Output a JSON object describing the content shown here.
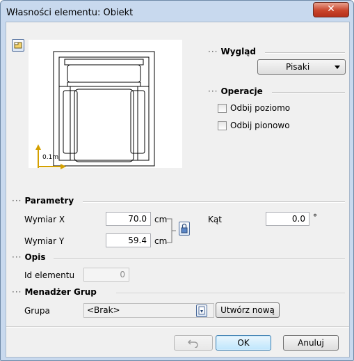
{
  "window": {
    "title": "Własności elementu: Obiekt",
    "close_glyph": "✕"
  },
  "preview": {
    "scale_label": "0.1m"
  },
  "wyglad": {
    "header": "Wygląd",
    "pens_dropdown": "Pisaki"
  },
  "operacje": {
    "header": "Operacje",
    "flip_h_label": "Odbij poziomo",
    "flip_v_label": "Odbij pionowo"
  },
  "parametry": {
    "header": "Parametry",
    "dim_x_label": "Wymiar X",
    "dim_x_value": "70.0",
    "dim_x_unit": "cm",
    "dim_y_label": "Wymiar Y",
    "dim_y_value": "59.4",
    "dim_y_unit": "cm",
    "angle_label": "Kąt",
    "angle_value": "0.0",
    "angle_unit": "°"
  },
  "opis": {
    "header": "Opis",
    "id_label": "Id elementu",
    "id_value": "0"
  },
  "grupy": {
    "header": "Menadżer Grup",
    "group_label": "Grupa",
    "group_value": "<Brak>",
    "create_button": "Utwórz nową"
  },
  "footer": {
    "ok_label": "OK",
    "cancel_label": "Anuluj"
  },
  "icons": [
    "preview-toggle-icon",
    "close-icon",
    "chevron-down-icon",
    "lock-icon",
    "group-edit-icon",
    "undo-icon"
  ]
}
